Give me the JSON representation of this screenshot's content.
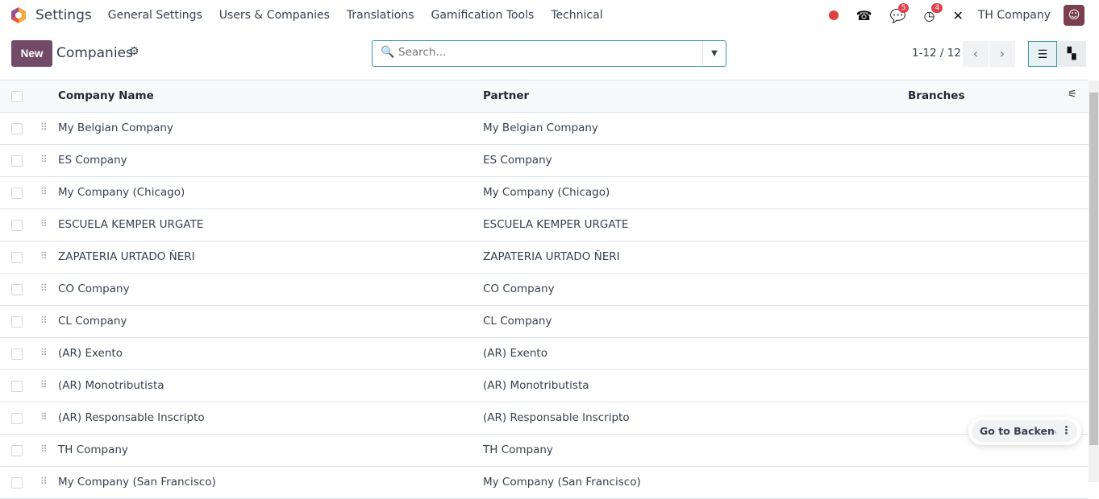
{
  "nav": {
    "app": "Settings",
    "menus": [
      "General Settings",
      "Users & Companies",
      "Translations",
      "Gamification Tools",
      "Technical"
    ],
    "messages_count": "5",
    "activities_count": "4",
    "company": "TH Company"
  },
  "control": {
    "new_label": "New",
    "title": "Companies",
    "search_placeholder": "Search...",
    "pager": "1-12 / 12"
  },
  "table": {
    "headers": [
      "Company Name",
      "Partner",
      "Branches"
    ],
    "rows": [
      [
        "My Belgian Company",
        "My Belgian Company"
      ],
      [
        "ES Company",
        "ES Company"
      ],
      [
        "My Company (Chicago)",
        "My Company (Chicago)"
      ],
      [
        "ESCUELA KEMPER URGATE",
        "ESCUELA KEMPER URGATE"
      ],
      [
        "ZAPATERIA URTADO ÑERI",
        "ZAPATERIA URTADO ÑERI"
      ],
      [
        "CO Company",
        "CO Company"
      ],
      [
        "CL Company",
        "CL Company"
      ],
      [
        "(AR) Exento",
        "(AR) Exento"
      ],
      [
        "(AR) Monotributista",
        "(AR) Monotributista"
      ],
      [
        "(AR) Responsable Inscripto",
        "(AR) Responsable Inscripto"
      ],
      [
        "TH Company",
        "TH Company"
      ],
      [
        "My Company (San Francisco)",
        "My Company (San Francisco)"
      ]
    ]
  },
  "floating": {
    "go_backend": "Go to Backend"
  },
  "colors": {
    "brand": "#714b67",
    "accent": "#3d9a9b",
    "badge": "#e0404a"
  }
}
